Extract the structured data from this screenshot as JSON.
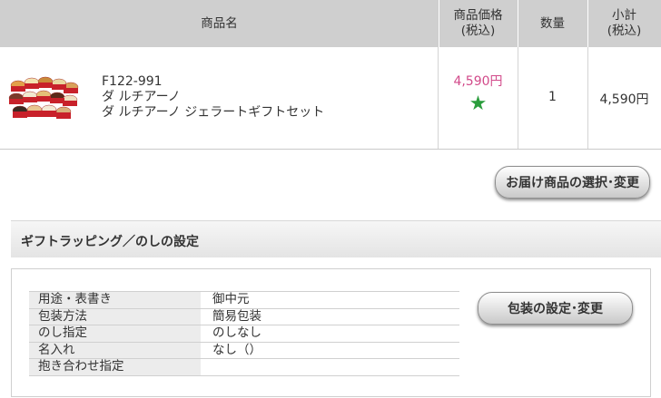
{
  "cart": {
    "headers": {
      "name": "商品名",
      "price": "商品価格\n(税込)",
      "qty": "数量",
      "subtotal": "小計\n(税込)"
    },
    "item": {
      "code": "F122-991",
      "brand": "ダ ルチアーノ",
      "name": "ダ ルチアーノ ジェラートギフトセット",
      "price": "4,590円",
      "quantity": "1",
      "subtotal": "4,590円",
      "star_color": "#2a9d3c"
    },
    "change_button": "お届け商品の選択･変更"
  },
  "gift": {
    "title": "ギフトラッピング／のしの設定",
    "settings": [
      {
        "label": "用途・表書き",
        "value": "御中元"
      },
      {
        "label": "包装方法",
        "value": "簡易包装"
      },
      {
        "label": "のし指定",
        "value": "のしなし"
      },
      {
        "label": "名入れ",
        "value": "なし（）"
      },
      {
        "label": "抱き合わせ指定",
        "value": ""
      }
    ],
    "change_button": "包装の設定･変更"
  },
  "colors": {
    "price": "#d24a8a",
    "header_bg": "#cfcfcf"
  }
}
